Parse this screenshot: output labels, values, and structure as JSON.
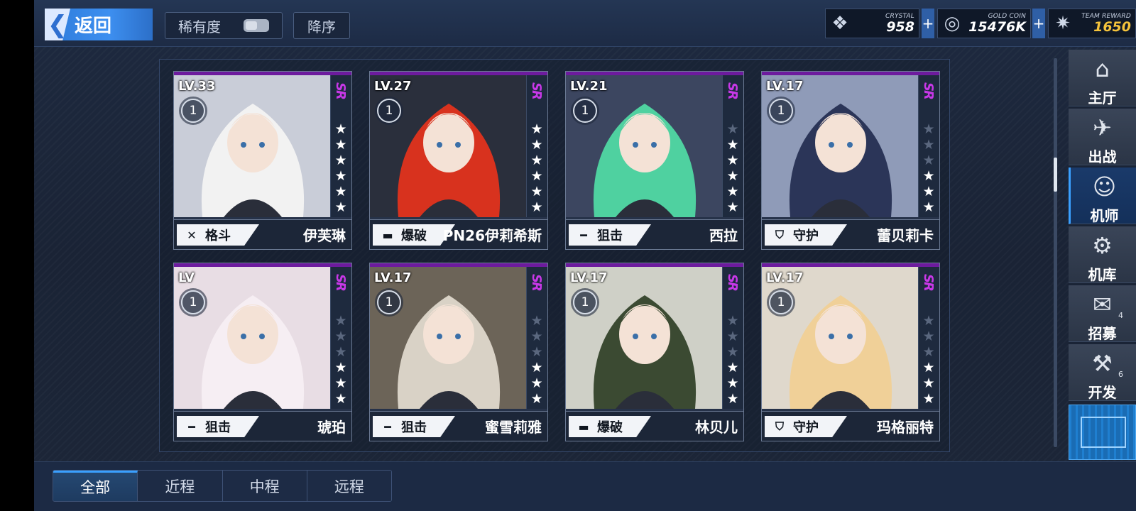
{
  "header": {
    "back_label": "返回",
    "rarity_label": "稀有度",
    "sort_label": "降序"
  },
  "currencies": [
    {
      "label": "CRYSTAL",
      "value": "958",
      "icon": "crystal-icon",
      "color": "#ffffff"
    },
    {
      "label": "GOLD COIN",
      "value": "15476K",
      "icon": "gold-coin-icon",
      "color": "#ffffff"
    },
    {
      "label": "TEAM REWARD",
      "value": "1650",
      "icon": "team-reward-icon",
      "color": "#f5c33b"
    }
  ],
  "colors": {
    "rarity": "#c838e8",
    "accent": "#3aa0ff",
    "card_topline": "#6d1b9e"
  },
  "cards": [
    {
      "level": "LV.33",
      "badge": "1",
      "rarity": "SR",
      "stars": 6,
      "type_icon": "fist-icon",
      "type": "格斗",
      "name": "伊芙琳",
      "hair": "#f2f2f2",
      "bg": "#c9cdd8"
    },
    {
      "level": "LV.27",
      "badge": "1",
      "rarity": "SR",
      "stars": 6,
      "type_icon": "bomb-icon",
      "type": "爆破",
      "name": "PN26伊莉希斯",
      "hair": "#d8321e",
      "bg": "#2a2f3c"
    },
    {
      "level": "LV.21",
      "badge": "1",
      "rarity": "SR",
      "stars": 5,
      "type_icon": "rifle-icon",
      "type": "狙击",
      "name": "西拉",
      "hair": "#4fd1a0",
      "bg": "#3c4660"
    },
    {
      "level": "LV.17",
      "badge": "1",
      "rarity": "SR",
      "stars": 3,
      "type_icon": "shield-icon",
      "type": "守护",
      "name": "蕾贝莉卡",
      "hair": "#2b3558",
      "bg": "#8f9bb8"
    },
    {
      "level": "LV",
      "badge": "1",
      "rarity": "SR",
      "stars": 3,
      "type_icon": "rifle-icon",
      "type": "狙击",
      "name": "琥珀",
      "hair": "#f6eef3",
      "bg": "#e8dde4"
    },
    {
      "level": "LV.17",
      "badge": "1",
      "rarity": "SR",
      "stars": 3,
      "type_icon": "rifle-icon",
      "type": "狙击",
      "name": "蜜雪莉雅",
      "hair": "#d9d2c6",
      "bg": "#6c6458"
    },
    {
      "level": "LV.17",
      "badge": "1",
      "rarity": "SR",
      "stars": 3,
      "type_icon": "bomb-icon",
      "type": "爆破",
      "name": "林贝儿",
      "hair": "#3b4a32",
      "bg": "#cfd0c7"
    },
    {
      "level": "LV.17",
      "badge": "1",
      "rarity": "SR",
      "stars": 3,
      "type_icon": "shield-icon",
      "type": "守护",
      "name": "玛格丽特",
      "hair": "#f0d098",
      "bg": "#dfd8cc"
    }
  ],
  "sidenav": [
    {
      "label": "主厅",
      "icon": "hall-icon",
      "badge": ""
    },
    {
      "label": "出战",
      "icon": "battle-icon",
      "badge": ""
    },
    {
      "label": "机师",
      "icon": "pilot-icon",
      "badge": "",
      "active": true
    },
    {
      "label": "机库",
      "icon": "hangar-icon",
      "badge": ""
    },
    {
      "label": "招募",
      "icon": "recruit-icon",
      "badge": "4"
    },
    {
      "label": "开发",
      "icon": "develop-icon",
      "badge": "6"
    }
  ],
  "tabs": [
    {
      "label": "全部",
      "active": true
    },
    {
      "label": "近程",
      "active": false
    },
    {
      "label": "中程",
      "active": false
    },
    {
      "label": "远程",
      "active": false
    }
  ]
}
